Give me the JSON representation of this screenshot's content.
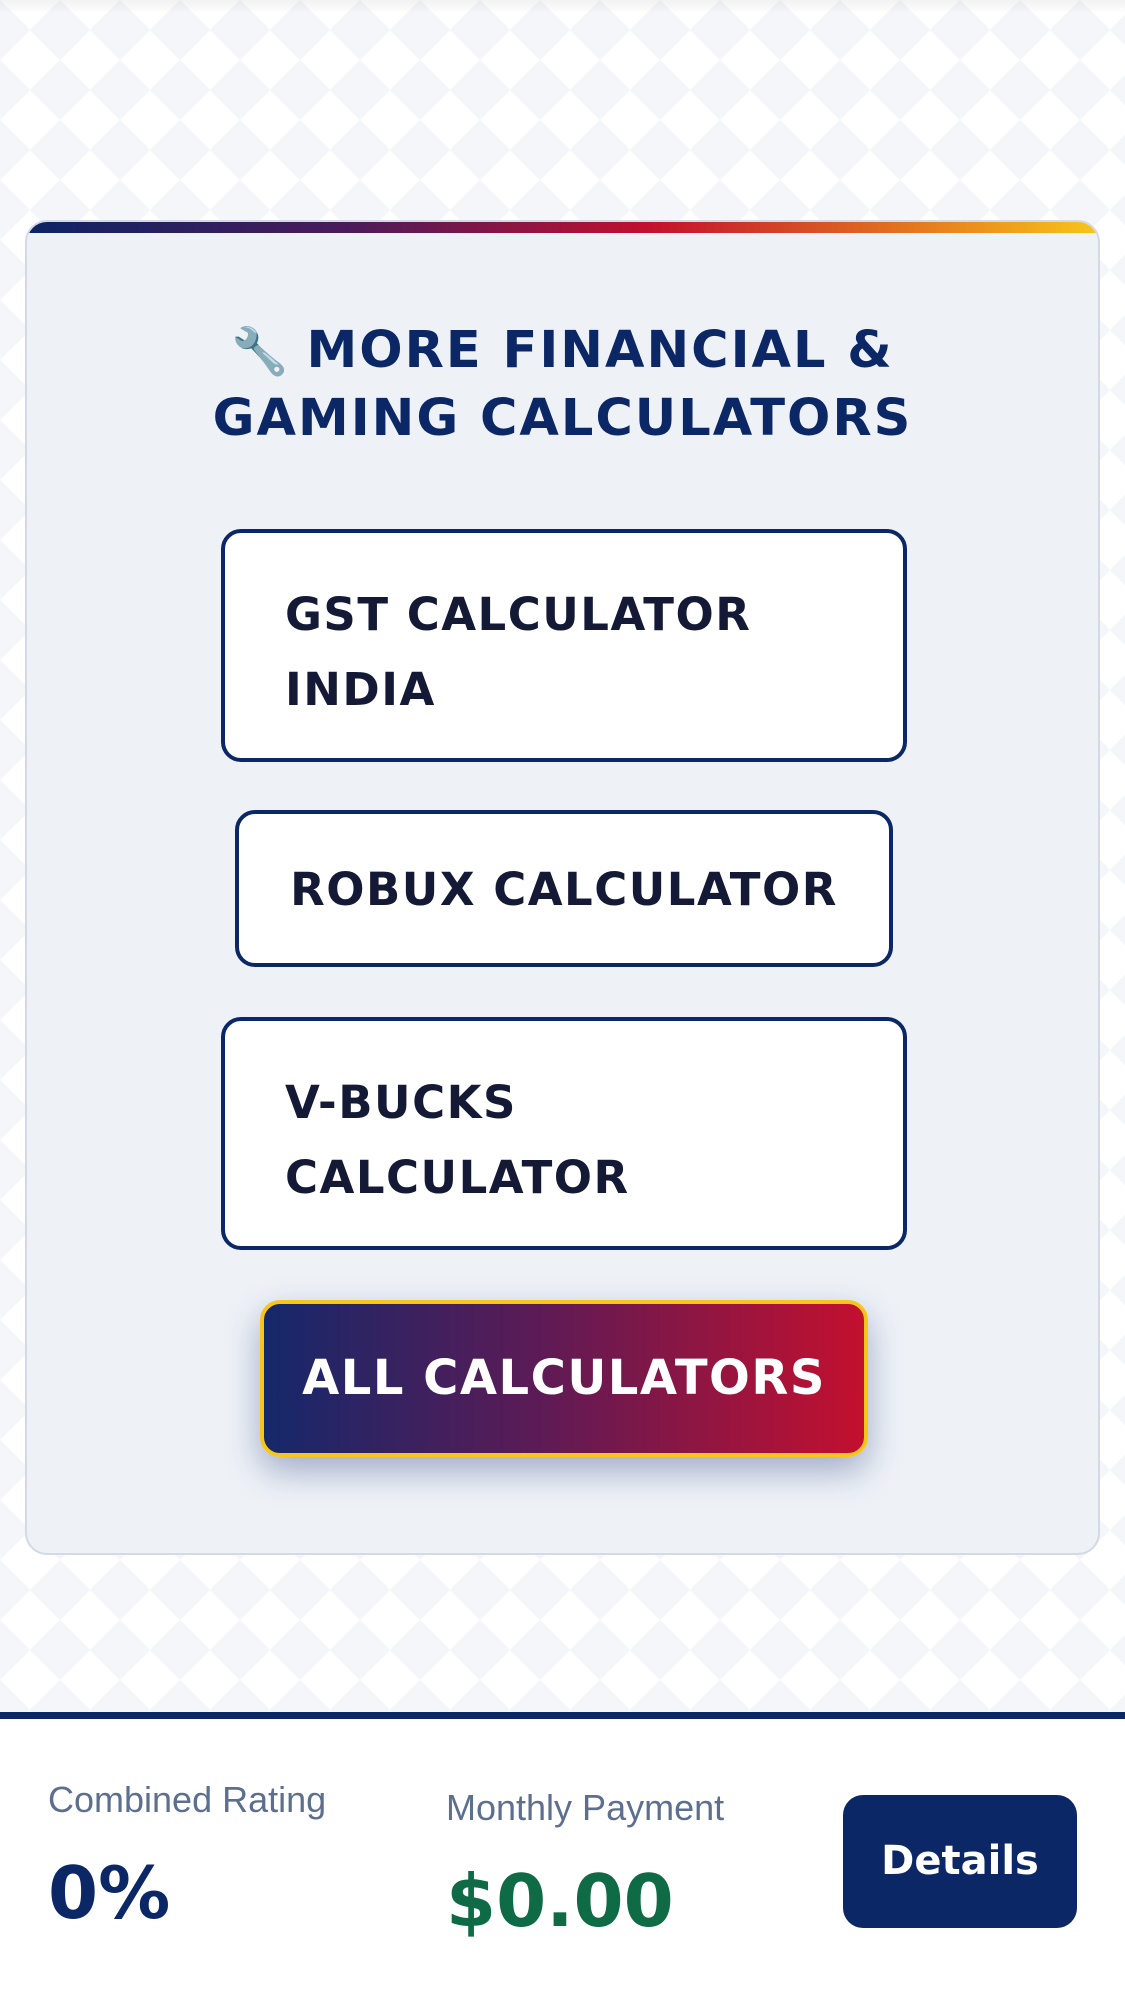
{
  "card": {
    "icon": "wrench-icon",
    "icon_glyph": "🔧",
    "title_line1": "MORE FINANCIAL &",
    "title_line2": "GAMING CALCULATORS"
  },
  "buttons": {
    "gst": [
      "GST CALCULATOR",
      "INDIA"
    ],
    "robux": "ROBUX CALCULATOR",
    "vbucks": [
      "V-BUCKS",
      "CALCULATOR"
    ],
    "all": "ALL CALCULATORS"
  },
  "footer": {
    "rating_label": "Combined Rating",
    "rating_value": "0%",
    "payment_label": "Monthly Payment",
    "payment_value": "$0.00",
    "details_label": "Details"
  },
  "colors": {
    "navy": "#0b2766",
    "accent_red": "#c3102f",
    "accent_yellow": "#f8c51b",
    "money_green": "#0f6b45"
  }
}
